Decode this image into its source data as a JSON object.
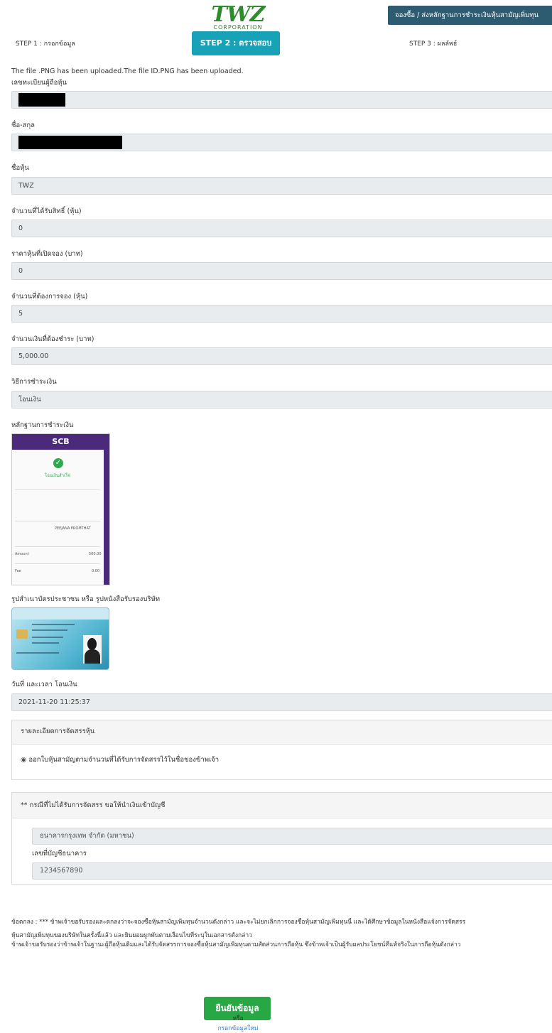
{
  "header": {
    "logo_text": "TWZ",
    "logo_sub": "CORPORATION",
    "top_button": "จองซื้อ / ส่งหลักฐานการชำระเงินหุ้นสามัญเพิ่มทุน",
    "steps": [
      "STEP 1 : กรอกข้อมูล",
      "STEP 2 : ตรวจสอบ",
      "STEP 3 : ผลลัพธ์"
    ],
    "active_step": 2
  },
  "upload_message": "The file .PNG has been uploaded.The file ID.PNG has been uploaded.",
  "fields": [
    {
      "label": "เลขทะเบียนผู้ถือหุ้น",
      "value": ""
    },
    {
      "label": "ชื่อ-สกุล",
      "value": ""
    },
    {
      "label": "ชื่อหุ้น",
      "value": "TWZ"
    },
    {
      "label": "จำนวนที่ได้รับสิทธิ์ (หุ้น)",
      "value": "0"
    },
    {
      "label": "ราคาหุ้นที่เปิดจอง (บาท)",
      "value": "0"
    },
    {
      "label": "จำนวนที่ต้องการจอง (หุ้น)",
      "value": "5"
    },
    {
      "label": "จำนวนเงินที่ต้องชำระ (บาท)",
      "value": "5,000.00"
    },
    {
      "label": "วิธีการชำระเงิน",
      "value": "โอนเงิน"
    }
  ],
  "payment_proof_label": "หลักฐานการชำระเงิน",
  "receipt": {
    "bank": "SCB",
    "status": "โอนเงินสำเร็จ",
    "to": "PEEJANA PROMTHAT",
    "amount_label": "Amount",
    "amount": "500.00",
    "fee_label": "Fee",
    "fee": "0.00"
  },
  "id_label": "รูปสำเนาบัตรประชาชน หรือ รูปหนังสือรับรองบริษัท",
  "datetime_label": "วันที่ และเวลา โอนเงิน",
  "datetime_value": "2021-11-20 11:25:37",
  "allocation_panel": {
    "title": "รายละเอียดการจัดสรรหุ้น",
    "option": "ออกใบหุ้นสามัญตามจำนวนที่ได้รับการจัดสรรไว้ในชื่อของข้าพเจ้า"
  },
  "refund_panel": {
    "title": "** กรณีที่ไม่ได้รับการจัดสรร ขอให้นำเงินเข้าบัญชี",
    "bank_value": "ธนาคารกรุงเทพ จำกัด (มหาชน)",
    "account_label": "เลขที่บัญชีธนาคาร",
    "account_value": "1234567890"
  },
  "terms": [
    "ข้อตกลง : *** ข้าพเจ้าขอรับรองและตกลงว่าจะจองซื้อหุ้นสามัญเพิ่มทุนจำนวนดังกล่าว และจะไม่ยกเลิกการจองซื้อหุ้นสามัญเพิ่มทุนนี้ และได้ศึกษาข้อมูลในหนังสือแจ้งการจัดสรร",
    "หุ้นสามัญเพิ่มทุนของบริษัทในครั้งนี้แล้ว และยินยอมผูกพันตามเงื่อนไขที่ระบุในเอกสารดังกล่าว",
    "ข้าพเจ้าขอรับรองว่าข้าพเจ้าในฐานะผู้ถือหุ้นเดิมและได้รับจัดสรรการจองซื้อหุ้นสามัญเพิ่มทุนตามสัดส่วนการถือหุ้น ซึ่งข้าพเจ้าเป็นผู้รับผลประโยชน์ที่แท้จริงในการถือหุ้นดังกล่าว"
  ],
  "confirm_button": "ยืนยันข้อมูล",
  "or_text": "หรือ",
  "reenter_link": "กรอกข้อมูลใหม่",
  "colors": {
    "accent": "#17a2b8",
    "topbar": "#2d5c71",
    "confirm": "#28a745",
    "scb": "#4b2a7b"
  }
}
